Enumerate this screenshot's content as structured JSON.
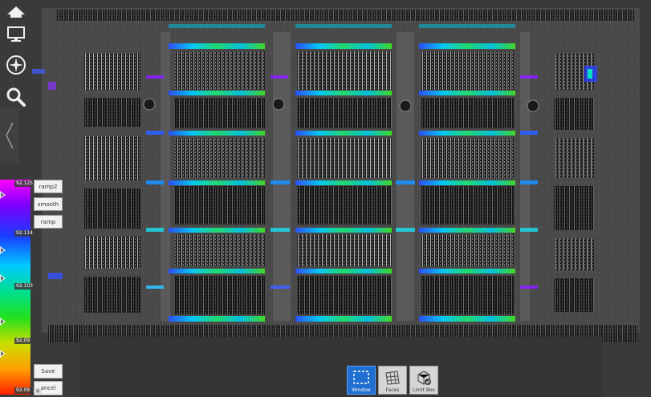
{
  "toolbar": {
    "icons": [
      "home-icon",
      "monitor-icon",
      "compass-icon",
      "search-icon"
    ]
  },
  "color_ramp": {
    "labels": [
      "92.125",
      "92.114",
      "92.103",
      "92.09",
      "92.08"
    ],
    "gradient": [
      "#ff00ff",
      "#7a00ff",
      "#1a3cff",
      "#00c8ff",
      "#00e090",
      "#20e020",
      "#c8e000",
      "#ffa000",
      "#ff2000"
    ]
  },
  "ramp_buttons": {
    "ramp2": "ramp2",
    "smooth": "smooth",
    "ramp": "ramp"
  },
  "actions": {
    "save": "Save",
    "cancel": "ancel"
  },
  "selection_tools": {
    "window": "Window",
    "faces": "Faces",
    "limit_box": "Limit Box"
  },
  "colors": {
    "background": "#3a3a3a",
    "active_tool": "#1e6fd0",
    "point_gray": "#8a8a8a",
    "highlight_band": [
      "#2060ff",
      "#00c8ff",
      "#00e070",
      "#40e020"
    ]
  }
}
